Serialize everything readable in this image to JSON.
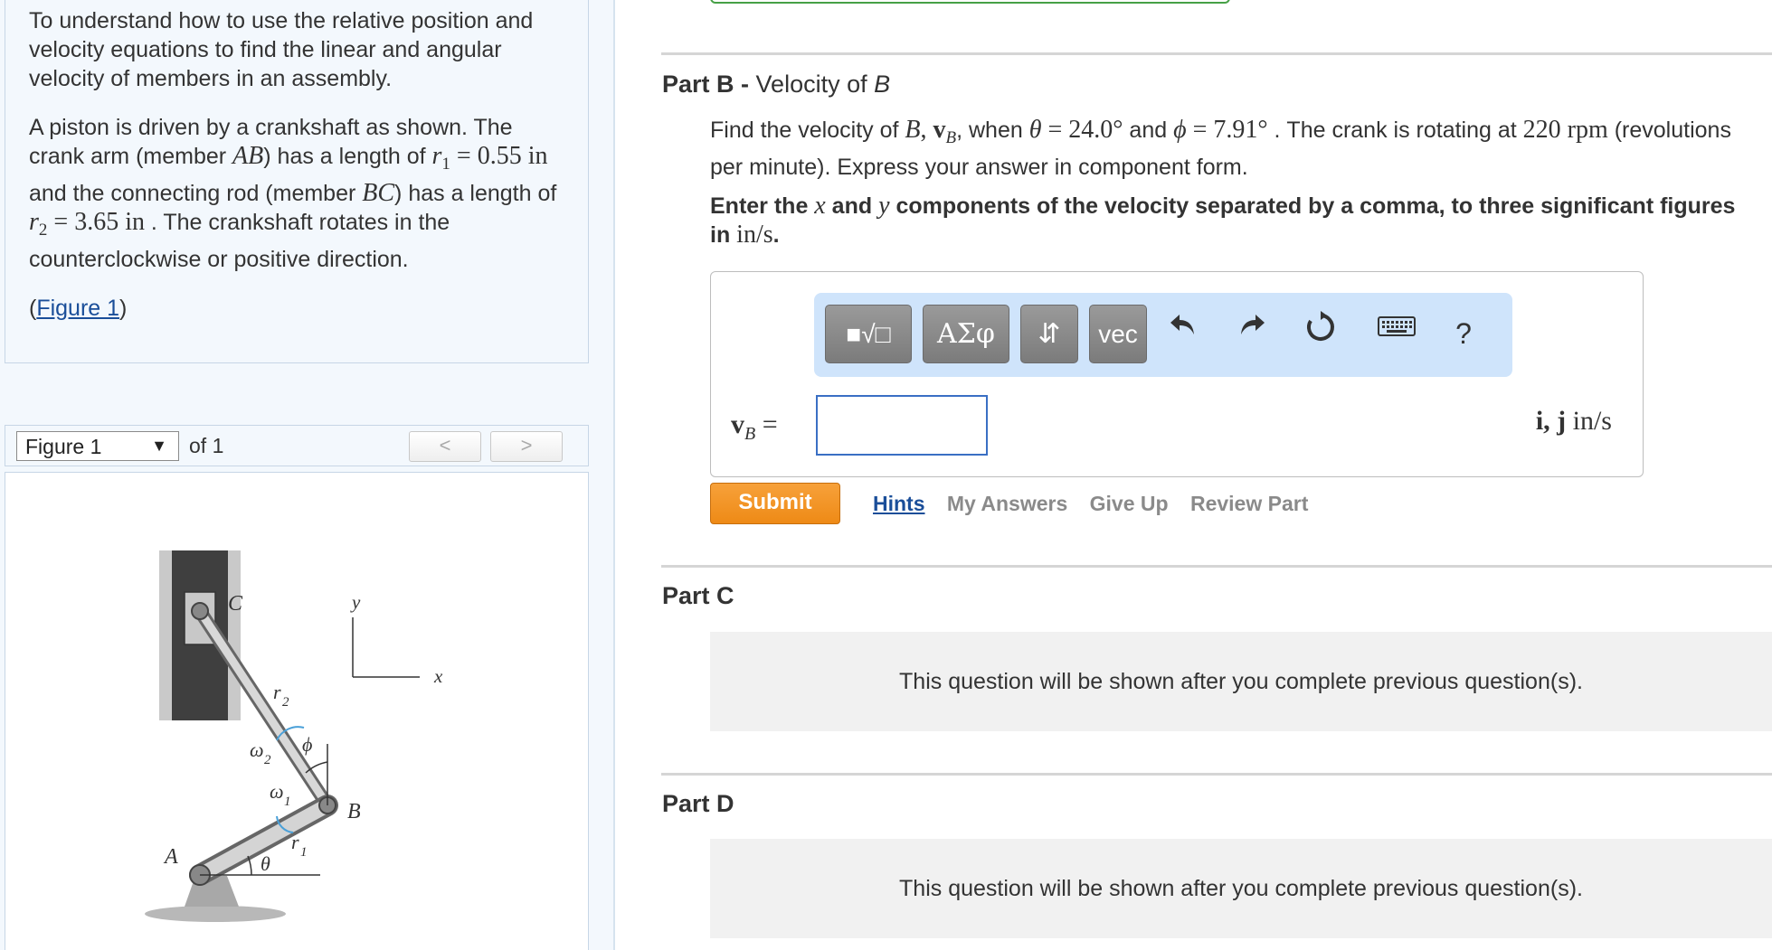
{
  "intro": {
    "paragraph1": "To understand how to use the relative position and velocity equations to find the linear and angular velocity of members in an assembly.",
    "p2_t1": "A piston is driven by a crankshaft as shown. The crank arm (member ",
    "p2_AB": "AB",
    "p2_t2": ") has a length of ",
    "p2_r": "r",
    "p2_r1sub": "1",
    "p2_r1val": " = 0.55 in",
    "p2_t3": " and the connecting rod (member ",
    "p2_BC": "BC",
    "p2_t4": ") has a length of ",
    "p2_r2sub": "2",
    "p2_r2val": " = 3.65 in",
    "p2_t5": " . The crankshaft rotates in the counterclockwise or positive direction.",
    "figure_open": "(",
    "figure_link": "Figure 1",
    "figure_close": ")"
  },
  "figure_toolbar": {
    "selected": "Figure 1",
    "of_text": "of 1",
    "prev": "<",
    "next": ">"
  },
  "figure": {
    "label_C": "C",
    "label_y": "y",
    "label_x": "x",
    "label_r2": "r",
    "label_r2_sub": "2",
    "label_omega2": "ω",
    "label_omega2_sub": "2",
    "label_phi": "ϕ",
    "label_omega1": "ω",
    "label_omega1_sub": "1",
    "label_B": "B",
    "label_A": "A",
    "label_theta": "θ",
    "label_r1": "r",
    "label_r1_sub": "1"
  },
  "partB": {
    "prefix": "Part B - ",
    "title": "Velocity of ",
    "title_var": "B",
    "q_t1": "Find the velocity of ",
    "q_B": "B",
    "q_comma": ", ",
    "q_v": "v",
    "q_vsub": "B",
    "q_t2": ", when ",
    "q_theta": "θ",
    "q_thetaval": " = 24.0°",
    "q_t3": " and ",
    "q_phi": "ϕ",
    "q_phival": " = 7.91°",
    "q_t4": " . The crank is rotating at ",
    "q_rpm": "220 rpm",
    "q_t5": " (revolutions per minute). Express your answer in component form.",
    "b_t1": "Enter the ",
    "b_x": "x",
    "b_t2": " and ",
    "b_y": "y",
    "b_t3": " components of the velocity separated by a comma, to three significant figures in ",
    "b_units": "in/s",
    "b_t4": "."
  },
  "toolbar": {
    "templates_icon": "■√□",
    "greek": "ΑΣφ",
    "arrows": "⇵",
    "vec": "vec",
    "undo": "undo-icon",
    "redo": "redo-icon",
    "reset": "reset-icon",
    "keyboard": "keyboard-icon",
    "help": "?"
  },
  "answer": {
    "label_v": "v",
    "label_sub": "B",
    "label_eq": " =",
    "value": "",
    "units_ij": "i, j",
    "units_text": " in/s"
  },
  "actions": {
    "submit": "Submit",
    "hints": "Hints",
    "my_answers": "My Answers",
    "give_up": "Give Up",
    "review_part": "Review Part"
  },
  "partC": {
    "title": "Part C",
    "locked": "This question will be shown after you complete previous question(s)."
  },
  "partD": {
    "title": "Part D",
    "locked": "This question will be shown after you complete previous question(s)."
  },
  "colors": {
    "link": "#1a4e99",
    "submit": "#ee8a16",
    "toolbar_bg": "#cfe4fb",
    "panel_bg": "#f3f8fd"
  }
}
